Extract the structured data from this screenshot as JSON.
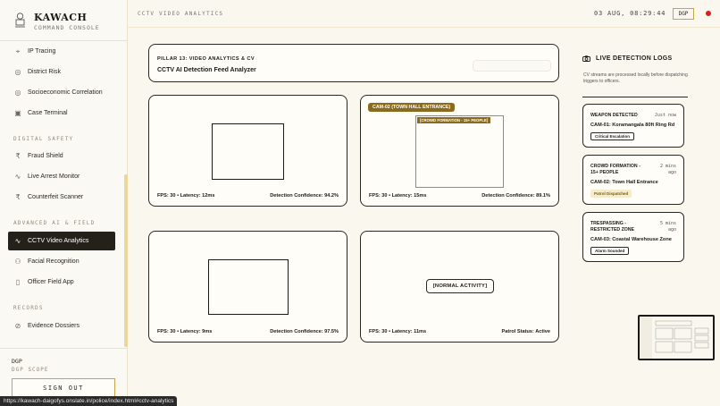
{
  "brand": {
    "title": "KAWACH",
    "subtitle": "COMMAND CONSOLE"
  },
  "topbar": {
    "page_title": "CCTV VIDEO ANALYTICS",
    "clock": "03 AUG, 08:29:44",
    "role_badge": "DGP"
  },
  "sidebar": {
    "items_top": [
      {
        "label": "IP Tracing",
        "icon": "crosshair-icon"
      },
      {
        "label": "District Risk",
        "icon": "target-icon"
      },
      {
        "label": "Socioeconomic Correlation",
        "icon": "target-icon"
      },
      {
        "label": "Case Terminal",
        "icon": "terminal-icon"
      }
    ],
    "section_digital": "DIGITAL SAFETY",
    "items_digital": [
      {
        "label": "Fraud Shield",
        "icon": "rupee-icon"
      },
      {
        "label": "Live Arrest Monitor",
        "icon": "pulse-icon"
      },
      {
        "label": "Counterfeit Scanner",
        "icon": "rupee-icon"
      }
    ],
    "section_ai": "ADVANCED AI & FIELD",
    "items_ai": [
      {
        "label": "CCTV Video Analytics",
        "icon": "pulse-icon",
        "active": true
      },
      {
        "label": "Facial Recognition",
        "icon": "user-icon"
      },
      {
        "label": "Officer Field App",
        "icon": "phone-icon"
      }
    ],
    "section_records": "RECORDS",
    "items_records": [
      {
        "label": "Evidence Dossiers",
        "icon": "check-circle-icon"
      }
    ],
    "footer": {
      "role": "DGP",
      "scope": "DGP SCOPE",
      "signout": "SIGN OUT"
    }
  },
  "header_card": {
    "kicker": "PILLAR 13: VIDEO ANALYTICS & CV",
    "title": "CCTV AI Detection Feed Analyzer"
  },
  "cameras": [
    {
      "meta": "FPS: 30 • Latency: 12ms",
      "status": "Detection Confidence: 94.2%"
    },
    {
      "label": "CAM-02 (TOWN HALL ENTRANCE)",
      "box_tag": "[CROWD FORMATION - 15+ PEOPLE]",
      "meta": "FPS: 30 • Latency: 15ms",
      "status": "Detection Confidence: 89.1%"
    },
    {
      "meta": "FPS: 30 • Latency: 9ms",
      "status": "Detection Confidence: 97.5%"
    },
    {
      "normal_tag": "[NORMAL ACTIVITY]",
      "meta": "FPS: 30 • Latency: 11ms",
      "status": "Patrol Status: Active"
    }
  ],
  "logs": {
    "title": "LIVE DETECTION LOGS",
    "description": "CV streams are processed locally before dispatching triggers to officers.",
    "entries": [
      {
        "title": "WEAPON DETECTED",
        "time": "Just now",
        "camera": "CAM-01: Koramangala 80ft Ring Rd",
        "tag": "Critical Escalation"
      },
      {
        "title": "CROWD FORMATION - 15+ PEOPLE",
        "time": "2 mins ago",
        "camera": "CAM-02: Town Hall Entrance",
        "tag": "Patrol Dispatched"
      },
      {
        "title": "TRESPASSING - RESTRICTED ZONE",
        "time": "5 mins ago",
        "camera": "CAM-03: Coastal Warehouse Zone",
        "tag": "Alarm Sounded"
      }
    ]
  },
  "status_url": "https://kawach-daigofys.onslate.in/police/index.html#cctv-analytics",
  "colors": {
    "accent_gold": "#c9a24a",
    "active_nav": "#24211b",
    "alert_red": "#d42020"
  }
}
